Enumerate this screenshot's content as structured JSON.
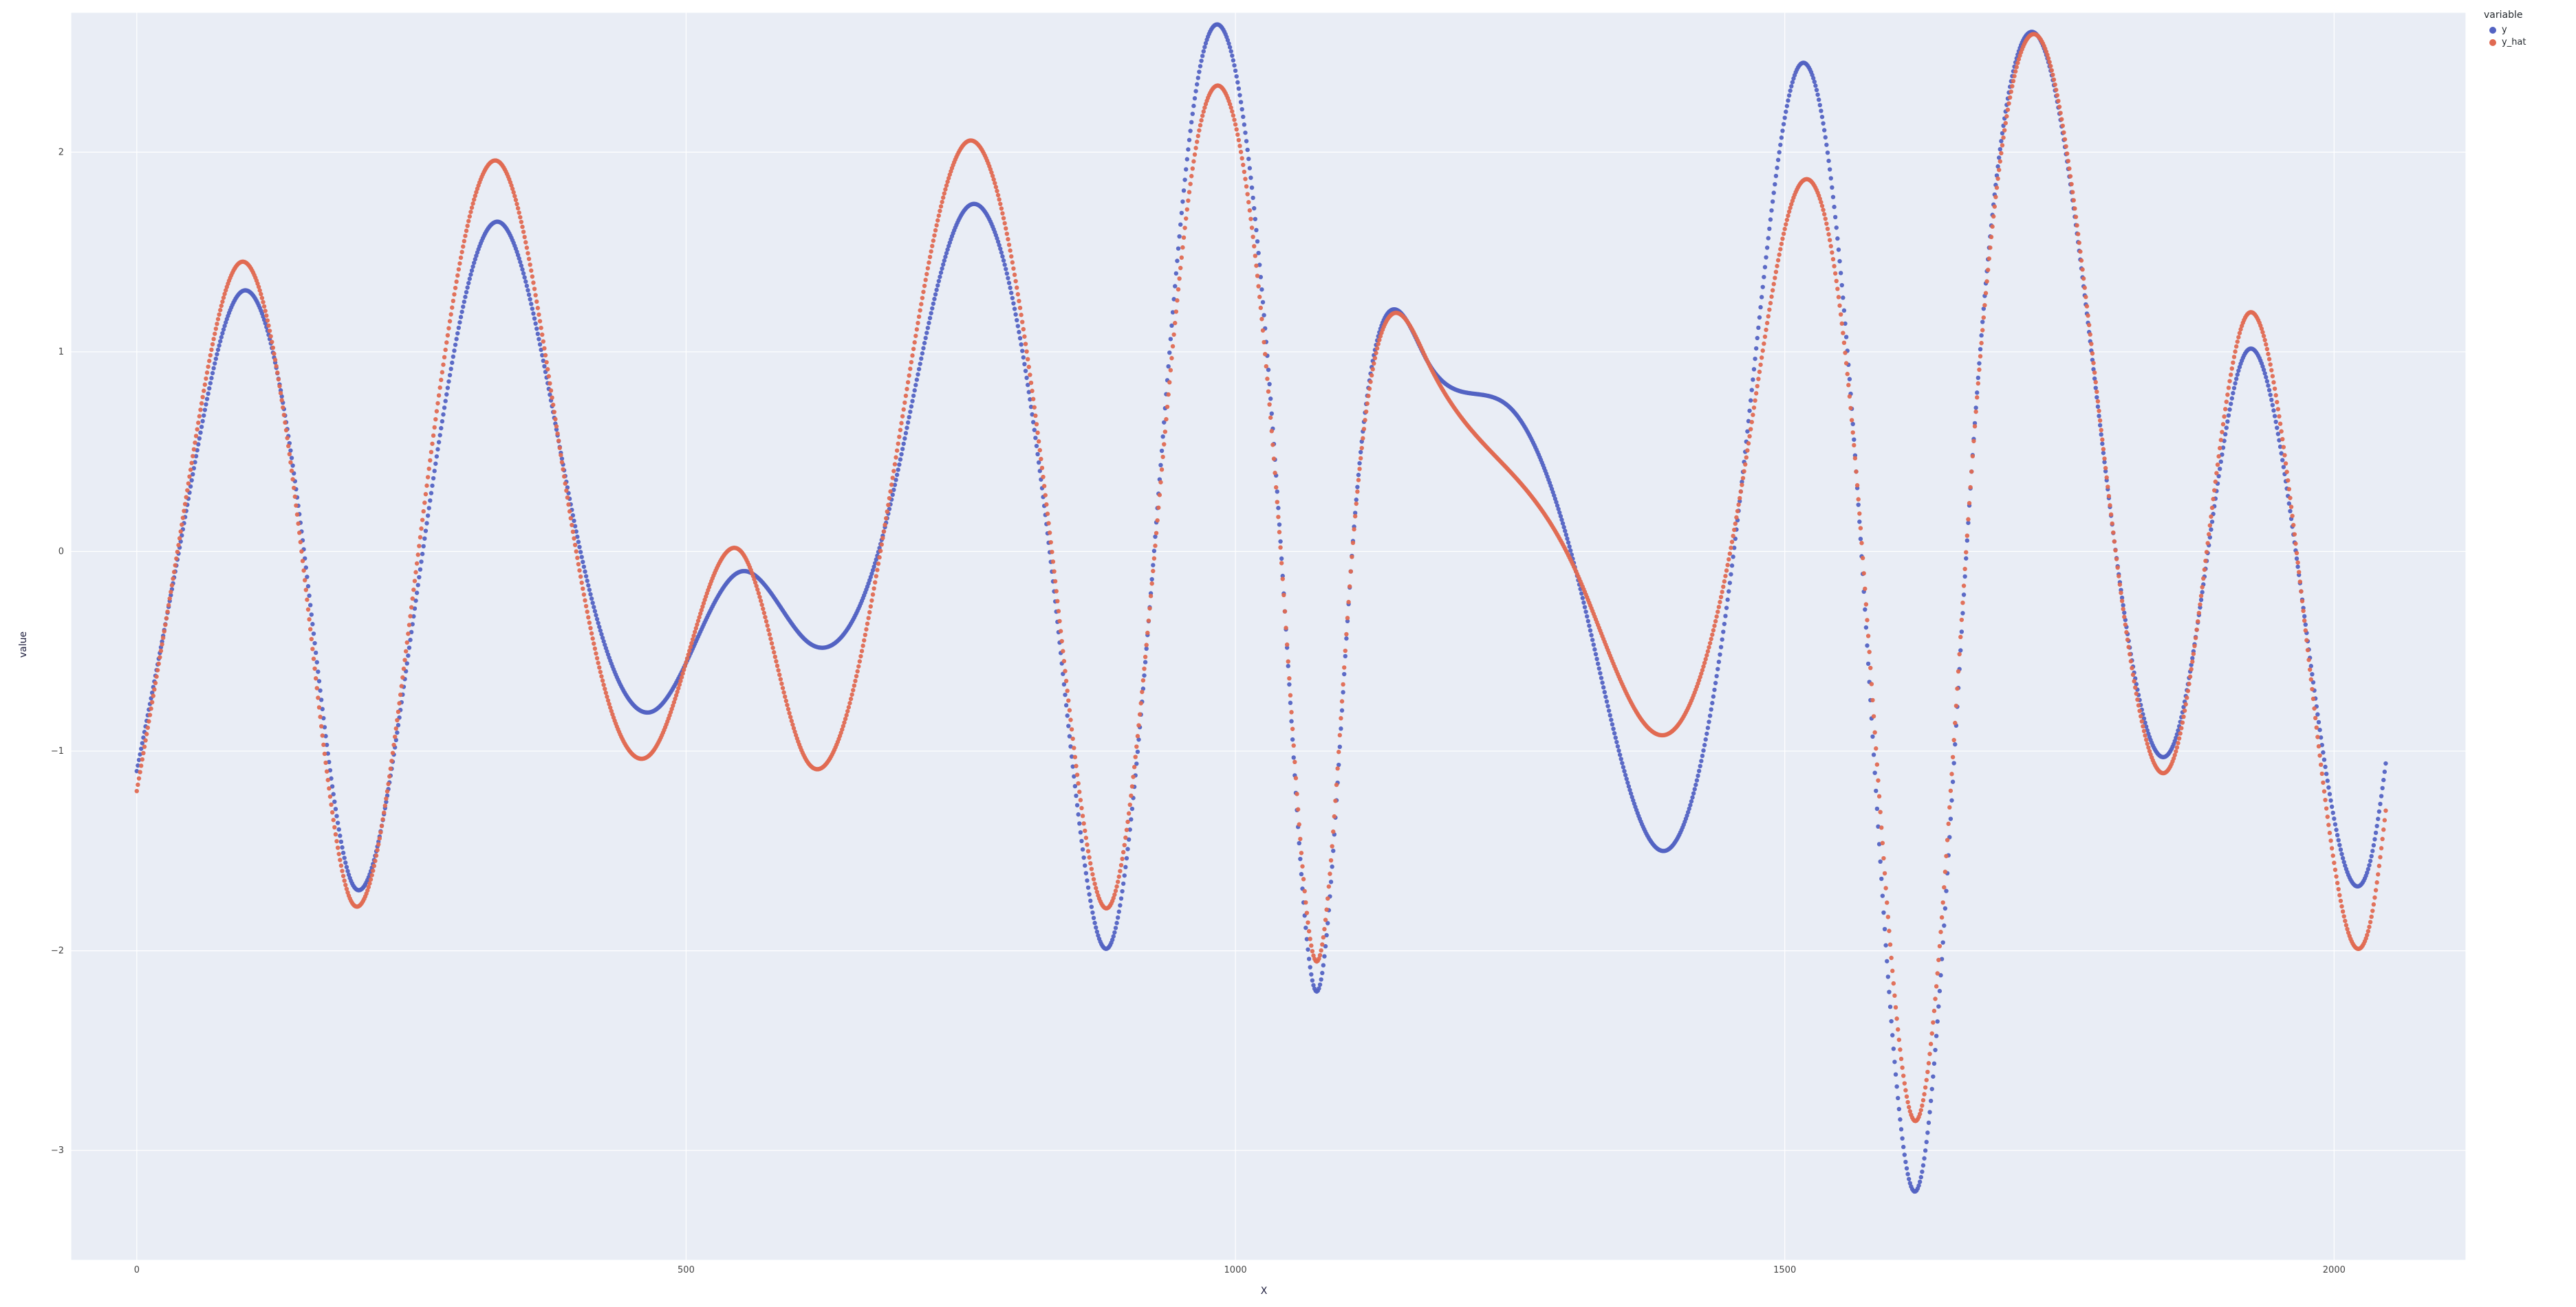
{
  "chart_data": {
    "type": "scatter",
    "xlabel": "X",
    "ylabel": "value",
    "legend_title": "variable",
    "legend_position": "right",
    "xlim": [
      -60,
      2120
    ],
    "ylim": [
      -3.55,
      2.7
    ],
    "xticks": [
      0,
      500,
      1000,
      1500,
      2000
    ],
    "yticks": [
      -3,
      -2,
      -1,
      0,
      1,
      2
    ],
    "grid": true,
    "n_points_per_series": 2048,
    "colors": {
      "y": "#5363c3",
      "y_hat": "#e06a52"
    },
    "panel_bg": "#e9edf5",
    "grid_color": "#ffffff",
    "series": [
      {
        "name": "y",
        "keypoints_x": [
          0,
          40,
          95,
          150,
          195,
          245,
          330,
          400,
          470,
          550,
          610,
          680,
          755,
          835,
          885,
          960,
          1045,
          1075,
          1105,
          1175,
          1250,
          1310,
          1390,
          1460,
          1510,
          1565,
          1620,
          1670,
          1740,
          1800,
          1855,
          1920,
          1970,
          2035,
          2048
        ],
        "keypoints_y": [
          -1.1,
          0.05,
          1.3,
          0.1,
          -1.65,
          -0.6,
          1.65,
          0.1,
          -0.8,
          -0.1,
          -0.45,
          0.1,
          1.72,
          -0.2,
          -1.98,
          2.15,
          -0.3,
          -2.2,
          -0.1,
          0.95,
          0.72,
          -0.1,
          -1.5,
          0.3,
          2.4,
          0.4,
          -3.2,
          0.4,
          2.45,
          0.05,
          -0.95,
          1.0,
          -0.2,
          -1.5,
          -1.02
        ]
      },
      {
        "name": "y_hat",
        "keypoints_x": [
          0,
          40,
          95,
          150,
          195,
          245,
          330,
          400,
          470,
          550,
          610,
          680,
          755,
          835,
          885,
          960,
          1045,
          1075,
          1105,
          1175,
          1250,
          1310,
          1390,
          1460,
          1510,
          1565,
          1620,
          1670,
          1740,
          1800,
          1855,
          1920,
          1970,
          2035,
          2048
        ],
        "keypoints_y": [
          -1.2,
          0.1,
          1.45,
          0.0,
          -1.75,
          -0.5,
          1.95,
          0.0,
          -1.0,
          0.0,
          -1.05,
          0.1,
          2.05,
          -0.1,
          -1.78,
          1.88,
          -0.3,
          -2.05,
          -0.1,
          0.95,
          0.4,
          -0.1,
          -0.92,
          0.3,
          1.8,
          0.4,
          -2.85,
          0.4,
          2.47,
          0.05,
          -1.02,
          1.18,
          -0.2,
          -1.8,
          -1.25
        ]
      }
    ]
  }
}
